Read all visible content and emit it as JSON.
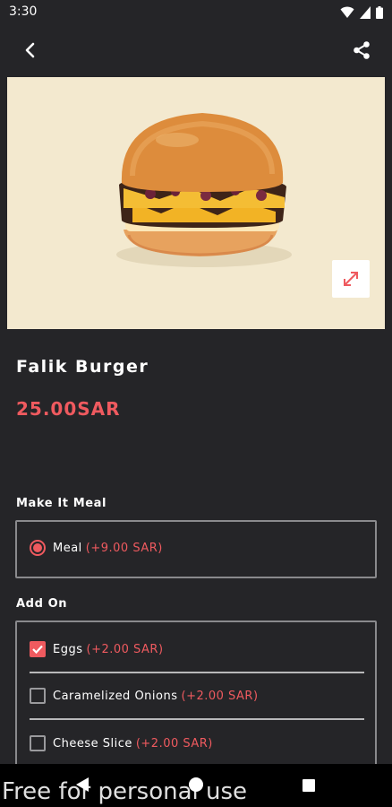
{
  "status_bar": {
    "time": "3:30"
  },
  "product": {
    "name": "Falik Burger",
    "price": "25.00SAR"
  },
  "meal_section": {
    "title": "Make It Meal",
    "options": [
      {
        "label": "Meal",
        "price": "(+9.00 SAR)",
        "selected": true
      }
    ]
  },
  "addon_section": {
    "title": "Add On",
    "options": [
      {
        "label": "Eggs",
        "price": "(+2.00 SAR)",
        "checked": true
      },
      {
        "label": "Caramelized Onions",
        "price": "(+2.00 SAR)",
        "checked": false
      },
      {
        "label": "Cheese Slice",
        "price": "(+2.00 SAR)",
        "checked": false
      }
    ]
  },
  "watermark": "Free for personal use",
  "colors": {
    "accent": "#ef5a5f",
    "background": "#252528",
    "image_bg": "#f3e9cf"
  }
}
